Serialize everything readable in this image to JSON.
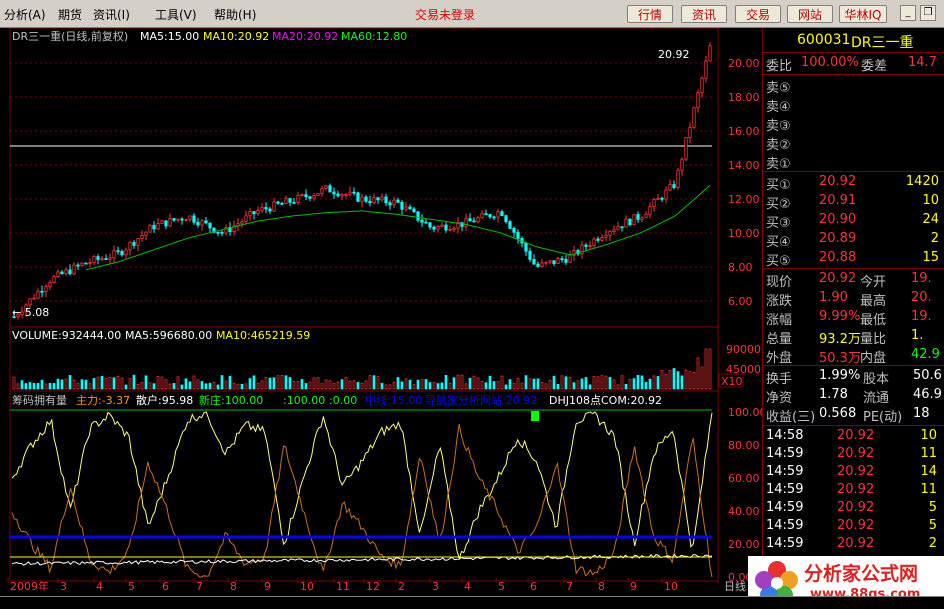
{
  "menu": {
    "items": [
      "分析(A)",
      "期货",
      "资讯(I)",
      "工具(V)",
      "帮助(H)"
    ],
    "login_status": "交易未登录"
  },
  "toolbar": {
    "buttons": [
      "行情",
      "资讯",
      "交易",
      "网站",
      "华林IQ"
    ]
  },
  "chart_header": {
    "title": "DR三一重(日线,前复权)",
    "ma5": "MA5:15.00",
    "ma10": "MA10:20.92",
    "ma20": "MA20:20.92",
    "ma60": "MA60:12.80"
  },
  "chart_data": [
    {
      "type": "line",
      "title": "DR三一重(日线,前复权)",
      "series": [
        {
          "name": "MA60",
          "x": [
            "2009-02",
            "2009-03",
            "2009-04",
            "2009-05",
            "2009-06",
            "2009-07",
            "2009-08",
            "2009-09",
            "2009-10",
            "2009-11",
            "2009-12",
            "2010-01",
            "2010-02",
            "2010-03",
            "2010-04",
            "2010-05",
            "2010-06",
            "2010-07",
            "2010-08",
            "2010-09",
            "2010-10"
          ],
          "values": [
            7.0,
            7.4,
            7.8,
            8.3,
            9.0,
            9.7,
            10.2,
            10.7,
            11.0,
            11.2,
            11.3,
            11.1,
            10.8,
            10.5,
            10.0,
            9.2,
            8.7,
            9.3,
            10.0,
            11.0,
            12.8
          ]
        },
        {
          "name": "Price",
          "x": [
            "2009-02",
            "2009-03",
            "2009-04",
            "2009-05",
            "2009-06",
            "2009-07",
            "2009-08",
            "2009-09",
            "2009-10",
            "2009-11",
            "2009-12",
            "2010-01",
            "2010-02",
            "2010-03",
            "2010-04",
            "2010-05",
            "2010-06",
            "2010-07",
            "2010-08",
            "2010-09",
            "2010-10"
          ],
          "values": [
            5.08,
            7.2,
            8.2,
            8.8,
            10.4,
            11.0,
            10.0,
            11.3,
            11.9,
            12.6,
            12.0,
            11.8,
            10.3,
            10.6,
            11.3,
            8.0,
            8.6,
            10.1,
            11.0,
            12.9,
            20.92
          ]
        }
      ],
      "ylim": [
        5,
        21
      ],
      "yticks": [
        "20.00",
        "18.00",
        "16.00",
        "14.00",
        "12.00",
        "10.00",
        "8.00",
        "6.00"
      ],
      "yvalues": [
        20,
        18,
        16,
        14,
        12,
        10,
        8,
        6
      ],
      "annotations": {
        "high": "20.92",
        "low": "← 5.08"
      }
    },
    {
      "type": "bar",
      "title": "VOLUME",
      "values": [
        932444.0
      ],
      "yticks": [
        "90000",
        "45000"
      ],
      "scale_label": "X10"
    },
    {
      "type": "line",
      "title": "筹码拥有量",
      "yticks": [
        "100.00",
        "80.00",
        "60.00",
        "40.00",
        "20.00",
        "0.00"
      ],
      "yvalues": [
        100,
        80,
        60,
        40,
        20,
        0
      ],
      "ylim": [
        0,
        100
      ]
    }
  ],
  "volume_header": {
    "volume": "VOLUME:932444.00",
    "ma5": "MA5:596680.00",
    "ma10": "MA10:465219.59"
  },
  "indicator_header": {
    "name": "筹码拥有量",
    "zhuli": "主力:-3.37",
    "sanhu": "散户:95.98",
    "xinzhuang": "新庄:100.00",
    "v1": ":100.00",
    "v2": ":0.00",
    "zhongxian": "中线:15.00",
    "daohang": "导航家分析网站:20.92",
    "dhj": "DHJ108点COM:20.92"
  },
  "xaxis": {
    "labels": [
      "2009年",
      "3",
      "4",
      "5",
      "6",
      "7",
      "8",
      "9",
      "10",
      "11",
      "12",
      "2",
      "3",
      "4",
      "5",
      "6",
      "7",
      "8",
      "9",
      "10"
    ],
    "end_label": "日线"
  },
  "quote": {
    "code": "600031",
    "name": "DR三一重",
    "weibi_label": "委比",
    "weibi_value": "100.00%",
    "weicha_label": "委差",
    "weicha_value": "14.7",
    "sell": [
      {
        "label": "卖⑤"
      },
      {
        "label": "卖④"
      },
      {
        "label": "卖③"
      },
      {
        "label": "卖②"
      },
      {
        "label": "卖①"
      }
    ],
    "buy": [
      {
        "label": "买①",
        "price": "20.92",
        "vol": "1420"
      },
      {
        "label": "买②",
        "price": "20.91",
        "vol": "10"
      },
      {
        "label": "买③",
        "price": "20.90",
        "vol": "24"
      },
      {
        "label": "买④",
        "price": "20.89",
        "vol": "2"
      },
      {
        "label": "买⑤",
        "price": "20.88",
        "vol": "15"
      }
    ],
    "stats": [
      {
        "l1": "现价",
        "v1": "20.92",
        "l2": "今开",
        "v2": "19."
      },
      {
        "l1": "涨跌",
        "v1": "1.90",
        "l2": "最高",
        "v2": "20."
      },
      {
        "l1": "涨幅",
        "v1": "9.99%",
        "l2": "最低",
        "v2": "19."
      },
      {
        "l1": "总量",
        "v1": "93.2万",
        "l2": "量比",
        "v2": "1."
      },
      {
        "l1": "外盘",
        "v1": "50.3万",
        "l2": "内盘",
        "v2": "42.9"
      }
    ],
    "fund": [
      {
        "l1": "换手",
        "v1": "1.99%",
        "l2": "股本",
        "v2": "50.6"
      },
      {
        "l1": "净资",
        "v1": "1.78",
        "l2": "流通",
        "v2": "46.9"
      },
      {
        "l1": "收益(三)",
        "v1": "0.568",
        "l2": "PE(动)",
        "v2": "18"
      }
    ],
    "ticks": [
      {
        "time": "14:58",
        "price": "20.92",
        "vol": "10"
      },
      {
        "time": "14:59",
        "price": "20.92",
        "vol": "11"
      },
      {
        "time": "14:59",
        "price": "20.92",
        "vol": "14"
      },
      {
        "time": "14:59",
        "price": "20.92",
        "vol": "11"
      },
      {
        "time": "14:59",
        "price": "20.92",
        "vol": "5"
      },
      {
        "time": "14:59",
        "price": "20.92",
        "vol": "5"
      },
      {
        "time": "14:59",
        "price": "20.92",
        "vol": "2"
      }
    ]
  },
  "logo": {
    "title": "分析家公式网",
    "url": "www.88gs.com"
  },
  "colors": {
    "red": "#ff3232",
    "yellow": "#ffff00",
    "green": "#00ff00",
    "magenta": "#ff00ff",
    "cyan": "#00ffff",
    "orange": "#ff9900",
    "blue": "#0000ff"
  }
}
